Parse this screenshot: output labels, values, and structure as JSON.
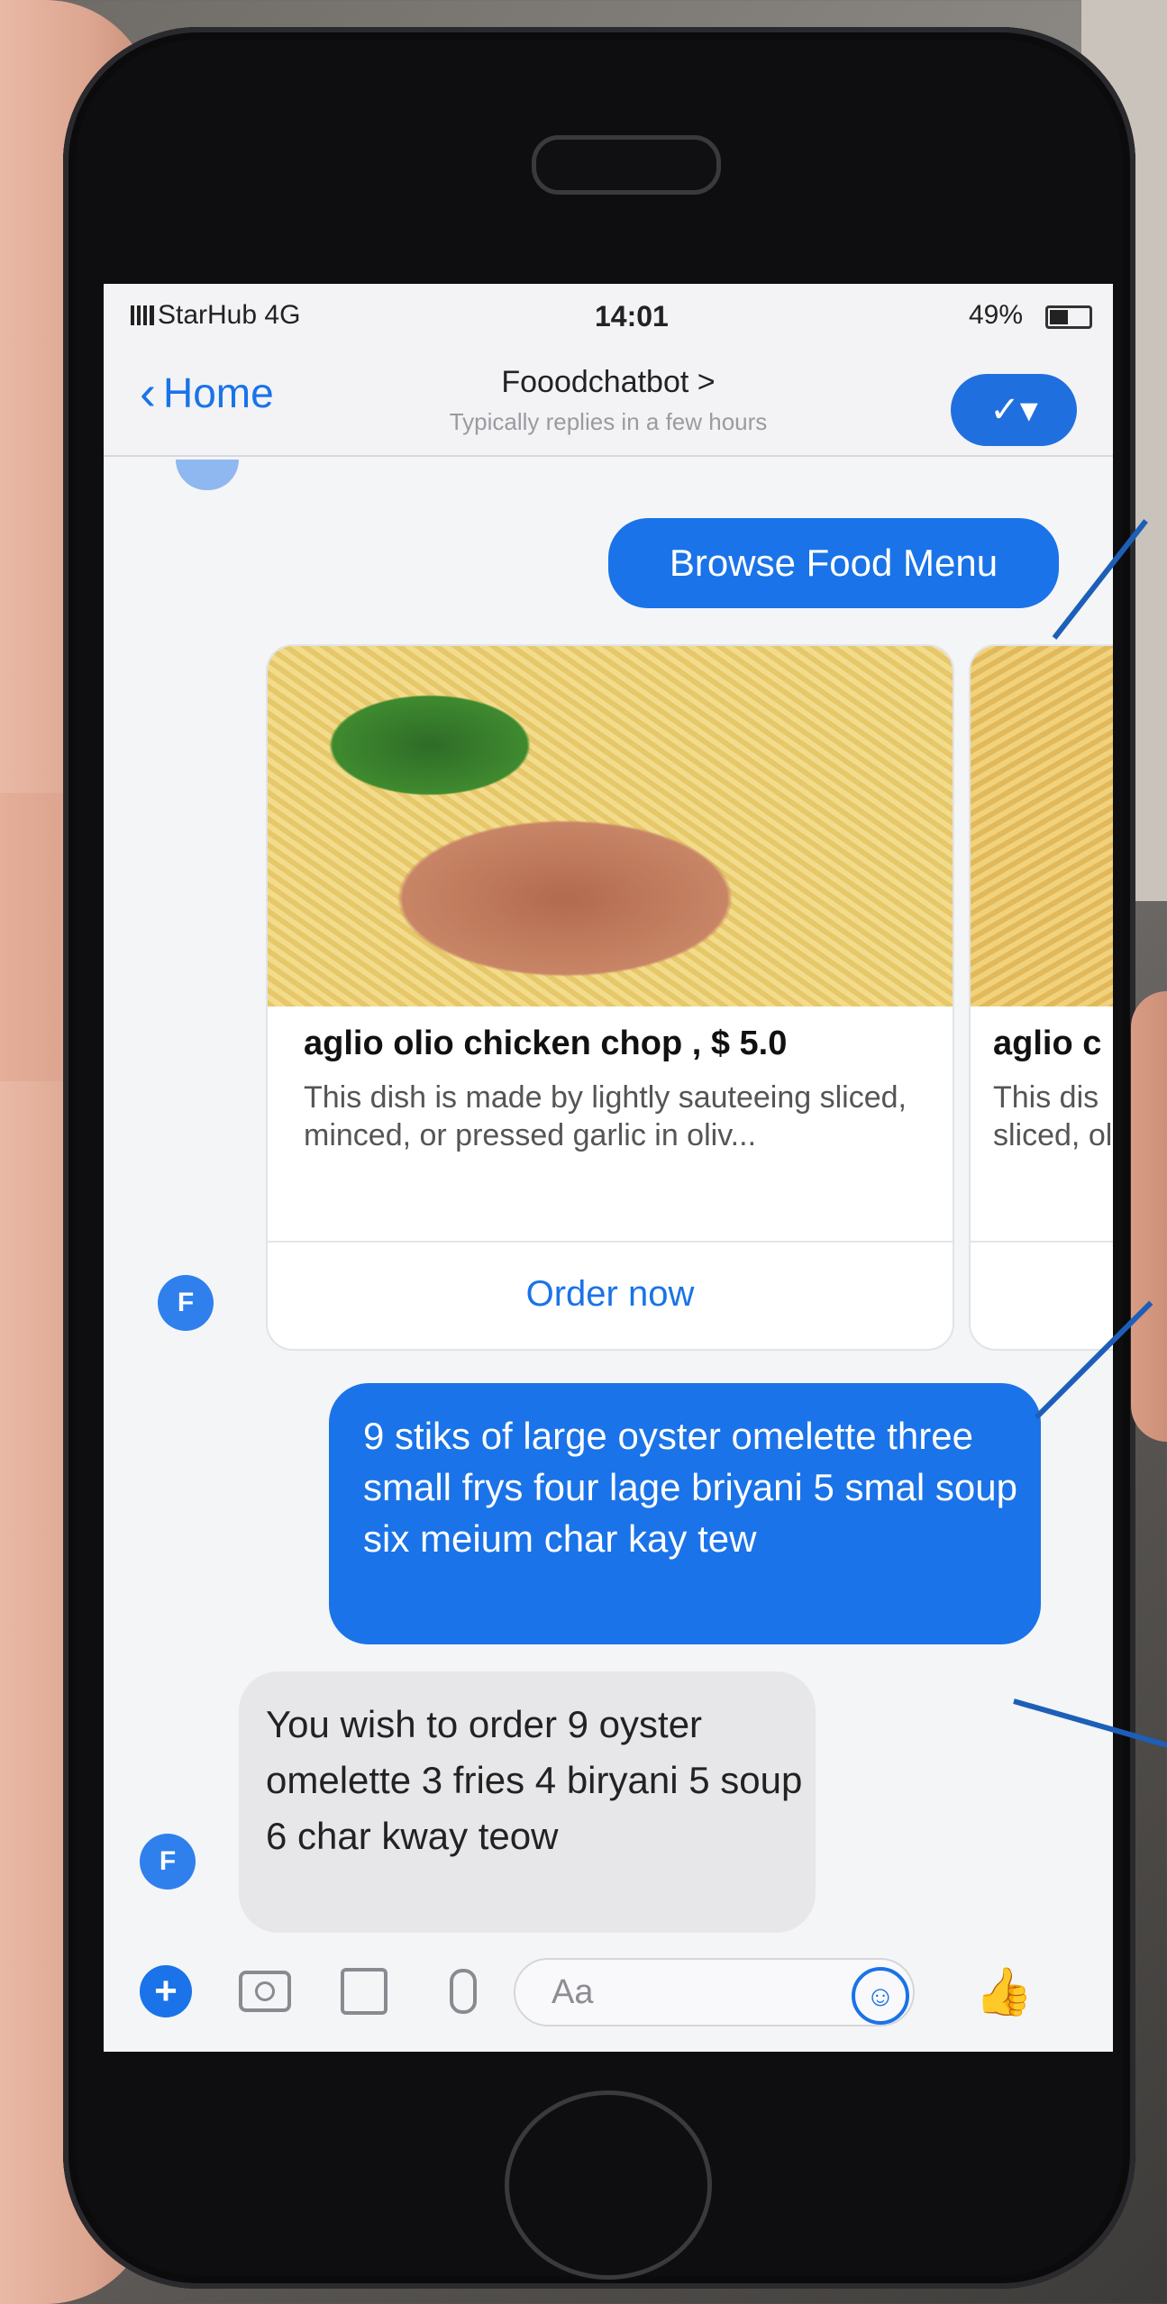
{
  "status_bar": {
    "carrier": "StarHub  4G",
    "time": "14:01",
    "battery": "49%"
  },
  "header": {
    "back_label": "Home",
    "title": "Fooodchatbot >",
    "subtitle": "Typically replies in a few hours",
    "check_icon": "check-dropdown-icon"
  },
  "messages": {
    "browse": "Browse Food Menu",
    "order": "9 stiks of large oyster omelette three small frys four lage briyani 5 smal soup six meium char kay tew",
    "reply": "You wish to order 9 oyster omelette 3 fries 4 biryani 5 soup 6 char kway teow"
  },
  "cards": [
    {
      "title": "aglio olio chicken chop , $ 5.0",
      "description": "This dish is made by lightly sauteeing sliced, minced, or pressed garlic in oliv...",
      "action": "Order now"
    },
    {
      "title": "aglio c",
      "description": "This dis sliced, oliv..."
    }
  ],
  "avatar_letter": "F",
  "composer": {
    "placeholder": "Aa"
  },
  "colors": {
    "accent": "#1a73e8",
    "bubble_incoming": "#e7e7ea",
    "annotation_line": "#1d5fb8"
  }
}
